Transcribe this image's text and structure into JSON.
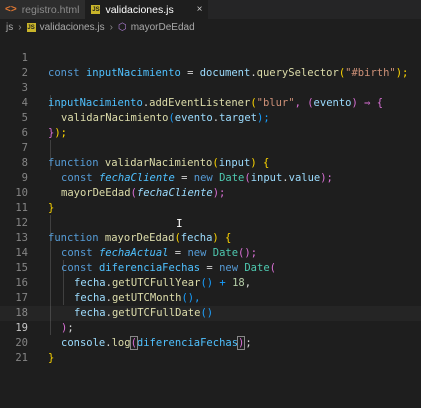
{
  "tabs": [
    {
      "label": "registro.html",
      "icon": "html-file-icon",
      "active": false
    },
    {
      "label": "validaciones.js",
      "icon": "js-file-icon",
      "active": true,
      "close": "×"
    }
  ],
  "breadcrumb": {
    "folder": "js",
    "file": "validaciones.js",
    "symbol": "mayorDeEdad",
    "icons": [
      "js-file-icon",
      "function-icon"
    ]
  },
  "line_numbers": [
    "1",
    "2",
    "3",
    "4",
    "5",
    "6",
    "7",
    "8",
    "9",
    "10",
    "11",
    "12",
    "13",
    "14",
    "15",
    "16",
    "17",
    "18",
    "19",
    "20",
    "21"
  ],
  "current_line": "19",
  "code": {
    "l1": [
      "const",
      "inputNacimiento",
      " = ",
      "document",
      ".",
      "querySelector",
      "(",
      "\"#birth\"",
      ");"
    ],
    "l3": [
      "inputNacimiento",
      ".",
      "addEventListener",
      "(",
      "\"blur\"",
      ", (",
      "evento",
      ") ⇒ ",
      "{"
    ],
    "l4": [
      "validarNacimiento",
      "(",
      "evento",
      ".",
      "target",
      ");"
    ],
    "l5": [
      "}",
      ");"
    ],
    "l7": [
      "function",
      "validarNacimiento",
      "(",
      "input",
      ") ",
      "{"
    ],
    "l8": [
      "const",
      "fechaCliente",
      " = ",
      "new",
      "Date",
      "(",
      "input",
      ".",
      "value",
      ");"
    ],
    "l9": [
      "mayorDeEdad",
      "(",
      "fechaCliente",
      ");"
    ],
    "l10": [
      "}"
    ],
    "l12": [
      "function",
      "mayorDeEdad",
      "(",
      "fecha",
      ") ",
      "{"
    ],
    "l13": [
      "const",
      "fechaActual",
      " = ",
      "new",
      "Date",
      "();"
    ],
    "l14": [
      "const",
      "diferenciaFechas",
      " = ",
      "new",
      "Date",
      "("
    ],
    "l15": [
      "fecha",
      ".",
      "getUTCFullYear",
      "() + ",
      "18",
      ","
    ],
    "l16": [
      "fecha",
      ".",
      "getUTCMonth",
      "(),"
    ],
    "l17": [
      "fecha",
      ".",
      "getUTCFullDate",
      "()"
    ],
    "l18": [
      ")",
      ";"
    ],
    "l19": [
      "console",
      ".",
      "log",
      "(",
      "diferenciaFechas",
      ")",
      ";"
    ],
    "l20": [
      "}"
    ]
  }
}
